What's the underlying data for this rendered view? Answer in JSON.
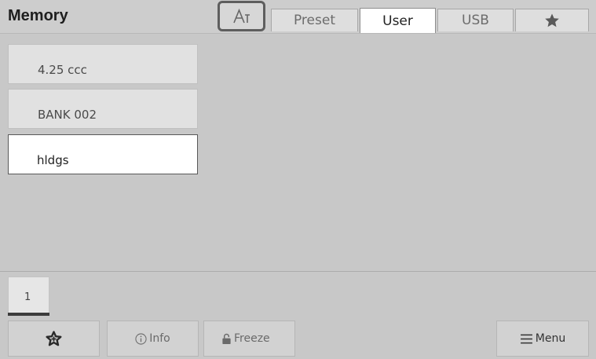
{
  "header": {
    "title": "Memory",
    "font_button_icon": "font-size-icon",
    "tabs": [
      {
        "label": "Preset",
        "active": false
      },
      {
        "label": "User",
        "active": true
      },
      {
        "label": "USB",
        "active": false
      },
      {
        "label": "",
        "icon": "star-icon",
        "active": false
      }
    ]
  },
  "list": {
    "items": [
      {
        "label": "4.25 ccc",
        "selected": false
      },
      {
        "label": "BANK 002",
        "selected": false
      },
      {
        "label": "hldgs",
        "selected": true
      }
    ]
  },
  "pagination": {
    "current_page": "1"
  },
  "footer": {
    "favorite_icon": "star-plus-icon",
    "info_label": "Info",
    "info_icon": "info-circle-icon",
    "freeze_label": "Freeze",
    "freeze_icon": "padlock-icon",
    "menu_label": "Menu",
    "menu_icon": "hamburger-icon"
  },
  "colors": {
    "background": "#c8c8c8",
    "selected_item": "#ffffff",
    "highlight_border": "#5e5e5e"
  }
}
